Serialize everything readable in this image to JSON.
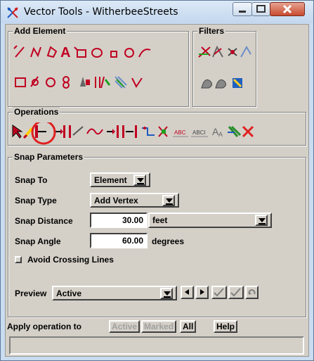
{
  "window": {
    "title": "Vector Tools - WitherbeeStreets"
  },
  "groups": {
    "add_element": "Add Element",
    "filters": "Filters",
    "operations": "Operations",
    "snap_parameters": "Snap Parameters"
  },
  "snap": {
    "snap_to_label": "Snap To",
    "snap_to_value": "Element",
    "snap_type_label": "Snap Type",
    "snap_type_value": "Add Vertex",
    "snap_distance_label": "Snap Distance",
    "snap_distance_value": "30.00",
    "snap_distance_unit": "feet",
    "snap_angle_label": "Snap Angle",
    "snap_angle_value": "60.00",
    "snap_angle_unit": "degrees",
    "avoid_crossing_label": "Avoid Crossing Lines"
  },
  "preview": {
    "label": "Preview",
    "value": "Active"
  },
  "apply": {
    "label": "Apply operation to",
    "active": "Active",
    "marked": "Marked",
    "all": "All",
    "help": "Help"
  },
  "colors": {
    "highlight_circle": "#e02020",
    "title_bg": "#c9dcf0"
  }
}
